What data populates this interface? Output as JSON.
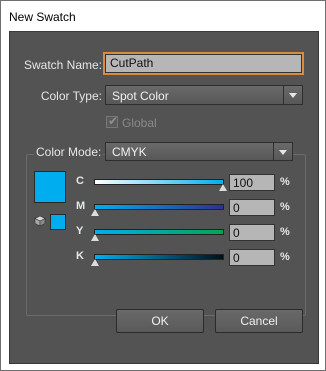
{
  "window": {
    "title": "New Swatch"
  },
  "form": {
    "swatch_name_label": "Swatch Name:",
    "swatch_name_value": "CutPath",
    "color_type_label": "Color Type:",
    "color_type_value": "Spot Color",
    "global_label": "Global",
    "global_checked": true,
    "color_mode_label": "Color Mode:",
    "color_mode_value": "CMYK"
  },
  "swatch_color": "#00aeef",
  "channels": [
    {
      "label": "C",
      "value": "100",
      "unit": "%",
      "level": 1.0
    },
    {
      "label": "M",
      "value": "0",
      "unit": "%",
      "level": 0.0
    },
    {
      "label": "Y",
      "value": "0",
      "unit": "%",
      "level": 0.0
    },
    {
      "label": "K",
      "value": "0",
      "unit": "%",
      "level": 0.0
    }
  ],
  "buttons": {
    "ok": "OK",
    "cancel": "Cancel"
  },
  "icons": {
    "out_of_gamut": "cube-icon",
    "dropdown": "chevron-down-icon"
  }
}
